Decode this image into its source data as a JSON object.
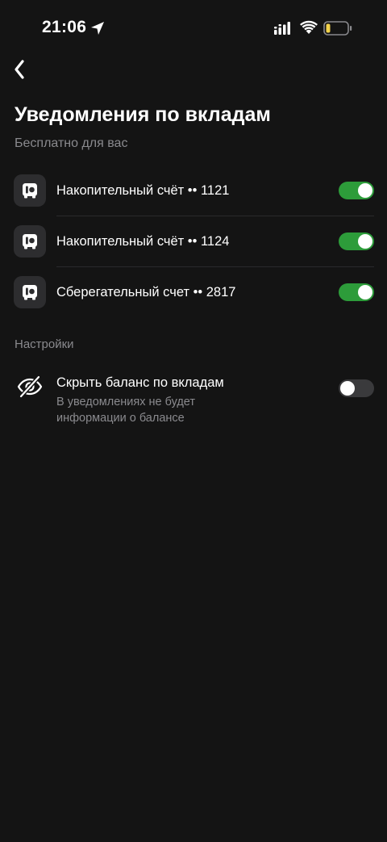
{
  "status_bar": {
    "time": "21:06"
  },
  "header": {
    "title": "Уведомления по вкладам",
    "subtitle": "Бесплатно для вас"
  },
  "accounts": [
    {
      "label": "Накопительный счёт •• 1121",
      "enabled": true
    },
    {
      "label": "Накопительный счёт •• 1124",
      "enabled": true
    },
    {
      "label": "Сберегательный счет •• 2817",
      "enabled": true
    }
  ],
  "settings": {
    "section_label": "Настройки",
    "hide_balance": {
      "title": "Скрыть баланс по вкладам",
      "description": "В уведомлениях не будет информации о балансе",
      "enabled": false
    }
  },
  "colors": {
    "background": "#141414",
    "toggle_on": "#2d9c3a",
    "toggle_off": "#3a3a3c",
    "secondary_text": "#8a8a8e",
    "battery_low": "#f2d24b"
  },
  "icons": {
    "back": "chevron-left-icon",
    "account": "safe-icon",
    "hide_balance": "eye-slash-icon"
  }
}
